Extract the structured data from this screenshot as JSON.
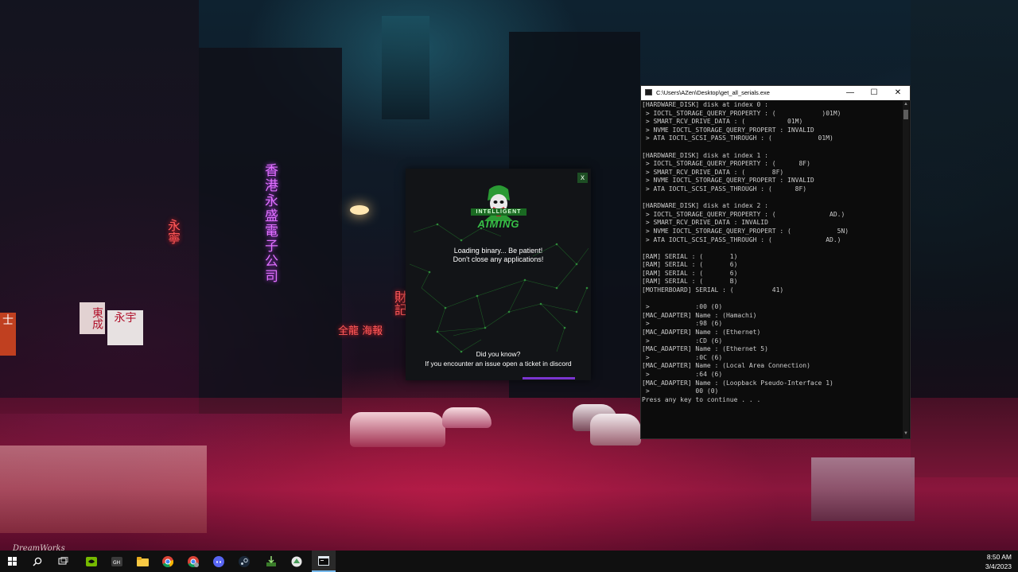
{
  "wallpaper": {
    "signs": {
      "vertical_neon": "香港永盛電子公司",
      "red_vertical_1": "永寧",
      "red_vertical_2": "財記",
      "red_row": "全龍 海報",
      "sign_box_1": "永宇",
      "sign_box_2": "東成",
      "sign_left": "士"
    },
    "logo_text": "DreamWorks"
  },
  "loader": {
    "close_label": "x",
    "logo_top": "INTELLIGENT",
    "logo_bottom": "AIMING",
    "message_line1": "Loading binary... Be patient!",
    "message_line2": "Don't close any applications!",
    "tip_title": "Did you know?",
    "tip_text": "If you encounter an issue open a ticket in discord",
    "accent_color": "#7a35d0",
    "brand_color": "#38c048"
  },
  "console": {
    "title": "C:\\Users\\AZen\\Desktop\\get_all_serials.exe",
    "minimize_label": "—",
    "maximize_label": "☐",
    "close_label": "✕",
    "lines": [
      "[HARDWARE_DISK] disk at index 0 :",
      " > IOCTL_STORAGE_QUERY_PROPERTY : (            )01M)",
      " > SMART_RCV_DRIVE_DATA : (           01M)",
      " > NVME IOCTL_STORAGE_QUERY_PROPERT : INVALID",
      " > ATA IOCTL_SCSI_PASS_THROUGH : (            01M)",
      "",
      "[HARDWARE_DISK] disk at index 1 :",
      " > IOCTL_STORAGE_QUERY_PROPERTY : (      8F)",
      " > SMART_RCV_DRIVE_DATA : (       8F)",
      " > NVME IOCTL_STORAGE_QUERY_PROPERT : INVALID",
      " > ATA IOCTL_SCSI_PASS_THROUGH : (      8F)",
      "",
      "[HARDWARE_DISK] disk at index 2 :",
      " > IOCTL_STORAGE_QUERY_PROPERTY : (              AD.)",
      " > SMART_RCV_DRIVE_DATA : INVALID",
      " > NVME IOCTL_STORAGE_QUERY_PROPERT : (            5N)",
      " > ATA IOCTL_SCSI_PASS_THROUGH : (              AD.)",
      "",
      "[RAM] SERIAL : (       1)",
      "[RAM] SERIAL : (       6)",
      "[RAM] SERIAL : (       6)",
      "[RAM] SERIAL : (       B)",
      "[MOTHERBOARD] SERIAL : (          41)",
      "",
      " >            :00 (0)",
      "[MAC_ADAPTER] Name : (Hamachi)",
      " >            :98 (6)",
      "[MAC_ADAPTER] Name : (Ethernet)",
      " >            :CD (6)",
      "[MAC_ADAPTER] Name : (Ethernet 5)",
      " >            :0C (6)",
      "[MAC_ADAPTER] Name : (Local Area Connection)",
      " >            :64 (6)",
      "[MAC_ADAPTER] Name : (Loopback Pseudo-Interface 1)",
      " >            00 (0)",
      "Press any key to continue . . ."
    ]
  },
  "taskbar": {
    "items": [
      "windows-start-icon",
      "search-icon",
      "task-view-icon",
      "nvidia-icon",
      "terminal-app-icon",
      "file-explorer-icon",
      "chrome-icon",
      "chrome-profile-icon",
      "discord-icon",
      "steam-icon",
      "installer-icon",
      "browser-icon",
      "console-app-icon"
    ],
    "time": "8:50 AM",
    "date": "3/4/2023"
  }
}
